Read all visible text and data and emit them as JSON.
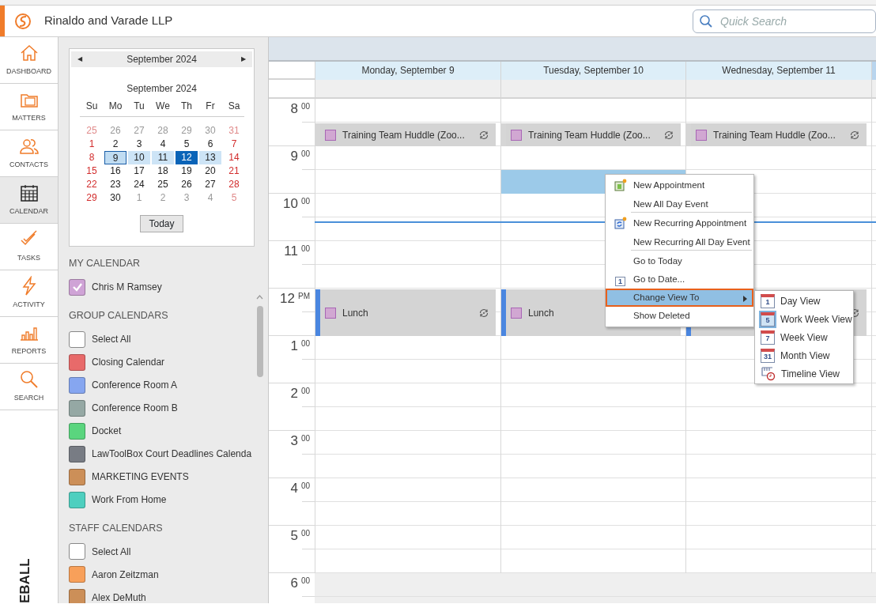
{
  "app": {
    "title": "Rinaldo and Varade LLP",
    "search_placeholder": "Quick Search"
  },
  "nav": [
    {
      "label": "DASHBOARD",
      "selected": false
    },
    {
      "label": "MATTERS",
      "selected": false
    },
    {
      "label": "CONTACTS",
      "selected": false
    },
    {
      "label": "CALENDAR",
      "selected": true
    },
    {
      "label": "TASKS",
      "selected": false
    },
    {
      "label": "ACTIVITY",
      "selected": false
    },
    {
      "label": "REPORTS",
      "selected": false
    },
    {
      "label": "SEARCH",
      "selected": false
    }
  ],
  "brand_vertical": "EBALL",
  "mini_calendar": {
    "header_title": "September 2024",
    "prev": "◀",
    "next": "▶",
    "title": "September 2024",
    "weekdays": [
      "Su",
      "Mo",
      "Tu",
      "We",
      "Th",
      "Fr",
      "Sa"
    ],
    "weeks": [
      [
        {
          "day": "25",
          "in_month": false,
          "selected": false,
          "today": false,
          "focused": false
        },
        {
          "day": "26",
          "in_month": false,
          "selected": false,
          "today": false,
          "focused": false
        },
        {
          "day": "27",
          "in_month": false,
          "selected": false,
          "today": false,
          "focused": false
        },
        {
          "day": "28",
          "in_month": false,
          "selected": false,
          "today": false,
          "focused": false
        },
        {
          "day": "29",
          "in_month": false,
          "selected": false,
          "today": false,
          "focused": false
        },
        {
          "day": "30",
          "in_month": false,
          "selected": false,
          "today": false,
          "focused": false
        },
        {
          "day": "31",
          "in_month": false,
          "selected": false,
          "today": false,
          "focused": false
        }
      ],
      [
        {
          "day": "1",
          "in_month": true,
          "selected": false,
          "today": false,
          "focused": false
        },
        {
          "day": "2",
          "in_month": true,
          "selected": false,
          "today": false,
          "focused": false
        },
        {
          "day": "3",
          "in_month": true,
          "selected": false,
          "today": false,
          "focused": false
        },
        {
          "day": "4",
          "in_month": true,
          "selected": false,
          "today": false,
          "focused": false
        },
        {
          "day": "5",
          "in_month": true,
          "selected": false,
          "today": false,
          "focused": false
        },
        {
          "day": "6",
          "in_month": true,
          "selected": false,
          "today": false,
          "focused": false
        },
        {
          "day": "7",
          "in_month": true,
          "selected": false,
          "today": false,
          "focused": false
        }
      ],
      [
        {
          "day": "8",
          "in_month": true,
          "selected": false,
          "today": false,
          "focused": false
        },
        {
          "day": "9",
          "in_month": true,
          "selected": true,
          "today": true,
          "focused": false
        },
        {
          "day": "10",
          "in_month": true,
          "selected": true,
          "today": false,
          "focused": false
        },
        {
          "day": "11",
          "in_month": true,
          "selected": true,
          "today": false,
          "focused": false
        },
        {
          "day": "12",
          "in_month": true,
          "selected": true,
          "today": false,
          "focused": true
        },
        {
          "day": "13",
          "in_month": true,
          "selected": true,
          "today": false,
          "focused": false
        },
        {
          "day": "14",
          "in_month": true,
          "selected": false,
          "today": false,
          "focused": false
        }
      ],
      [
        {
          "day": "15",
          "in_month": true,
          "selected": false,
          "today": false,
          "focused": false
        },
        {
          "day": "16",
          "in_month": true,
          "selected": false,
          "today": false,
          "focused": false
        },
        {
          "day": "17",
          "in_month": true,
          "selected": false,
          "today": false,
          "focused": false
        },
        {
          "day": "18",
          "in_month": true,
          "selected": false,
          "today": false,
          "focused": false
        },
        {
          "day": "19",
          "in_month": true,
          "selected": false,
          "today": false,
          "focused": false
        },
        {
          "day": "20",
          "in_month": true,
          "selected": false,
          "today": false,
          "focused": false
        },
        {
          "day": "21",
          "in_month": true,
          "selected": false,
          "today": false,
          "focused": false
        }
      ],
      [
        {
          "day": "22",
          "in_month": true,
          "selected": false,
          "today": false,
          "focused": false
        },
        {
          "day": "23",
          "in_month": true,
          "selected": false,
          "today": false,
          "focused": false
        },
        {
          "day": "24",
          "in_month": true,
          "selected": false,
          "today": false,
          "focused": false
        },
        {
          "day": "25",
          "in_month": true,
          "selected": false,
          "today": false,
          "focused": false
        },
        {
          "day": "26",
          "in_month": true,
          "selected": false,
          "today": false,
          "focused": false
        },
        {
          "day": "27",
          "in_month": true,
          "selected": false,
          "today": false,
          "focused": false
        },
        {
          "day": "28",
          "in_month": true,
          "selected": false,
          "today": false,
          "focused": false
        }
      ],
      [
        {
          "day": "29",
          "in_month": true,
          "selected": false,
          "today": false,
          "focused": false
        },
        {
          "day": "30",
          "in_month": true,
          "selected": false,
          "today": false,
          "focused": false
        },
        {
          "day": "1",
          "in_month": false,
          "selected": false,
          "today": false,
          "focused": false
        },
        {
          "day": "2",
          "in_month": false,
          "selected": false,
          "today": false,
          "focused": false
        },
        {
          "day": "3",
          "in_month": false,
          "selected": false,
          "today": false,
          "focused": false
        },
        {
          "day": "4",
          "in_month": false,
          "selected": false,
          "today": false,
          "focused": false
        },
        {
          "day": "5",
          "in_month": false,
          "selected": false,
          "today": false,
          "focused": false
        }
      ]
    ],
    "today_button": "Today"
  },
  "calendar_sections": [
    {
      "title": "MY CALENDAR",
      "items": [
        {
          "label": "Chris M Ramsey",
          "color": "#cfa3d6",
          "checked": true
        }
      ]
    },
    {
      "title": "GROUP CALENDARS",
      "items": [
        {
          "label": "Select All",
          "checked": false
        },
        {
          "label": "Closing Calendar",
          "color": "#e86a6a",
          "checked": false
        },
        {
          "label": "Conference Room A",
          "color": "#86a6f0",
          "checked": false
        },
        {
          "label": "Conference Room B",
          "color": "#95a8a4",
          "checked": false
        },
        {
          "label": "Docket",
          "color": "#5ad57e",
          "checked": false
        },
        {
          "label": "LawToolBox Court Deadlines Calenda",
          "color": "#787c84",
          "checked": false
        },
        {
          "label": "MARKETING EVENTS",
          "color": "#cc8f58",
          "checked": false
        },
        {
          "label": "Work From Home",
          "color": "#4ecfbf",
          "checked": false
        }
      ]
    },
    {
      "title": "STAFF CALENDARS",
      "items": [
        {
          "label": "Select All",
          "checked": false
        },
        {
          "label": "Aaron Zeitzman",
          "color": "#f8a05a",
          "checked": false
        },
        {
          "label": "Alex DeMuth",
          "color": "#cc8f58",
          "checked": false
        }
      ]
    }
  ],
  "day_columns": [
    {
      "label": "Monday, September 9",
      "has_selection": false,
      "events": [
        {
          "title": "Training Team Huddle (Zoo...",
          "color": "#d6d6d6",
          "recurring": true
        },
        {
          "title": "Lunch",
          "color": "#4a86e0",
          "recurring": true
        }
      ]
    },
    {
      "label": "Tuesday, September 10",
      "has_selection": true,
      "events": [
        {
          "title": "Training Team Huddle (Zoo...",
          "color": "#d6d6d6",
          "recurring": true
        },
        {
          "title": "Lunch",
          "color": "#4a86e0",
          "recurring": false
        }
      ]
    },
    {
      "label": "Wednesday, September 11",
      "has_selection": false,
      "events": [
        {
          "title": "Training Team Huddle (Zoo...",
          "color": "#d6d6d6",
          "recurring": true
        },
        {
          "color": "#4a86e0",
          "recurring": true
        }
      ]
    }
  ],
  "hours": [
    {
      "hour": "8",
      "suffix": "00"
    },
    {
      "hour": "9",
      "suffix": "00"
    },
    {
      "hour": "10",
      "suffix": "00"
    },
    {
      "hour": "11",
      "suffix": "00"
    },
    {
      "hour": "12",
      "suffix": "PM"
    },
    {
      "hour": "1",
      "suffix": "00"
    },
    {
      "hour": "2",
      "suffix": "00"
    },
    {
      "hour": "3",
      "suffix": "00"
    },
    {
      "hour": "4",
      "suffix": "00"
    },
    {
      "hour": "5",
      "suffix": "00"
    },
    {
      "hour": "6",
      "suffix": "00"
    }
  ],
  "context_menu": {
    "items": [
      {
        "label": "New Appointment",
        "divider_below": false,
        "selected": false,
        "has_submenu": false
      },
      {
        "label": "New All Day Event",
        "divider_below": true,
        "selected": false,
        "has_submenu": false
      },
      {
        "label": "New Recurring Appointment",
        "divider_below": false,
        "selected": false,
        "has_submenu": false
      },
      {
        "label": "New Recurring All Day Event",
        "divider_below": true,
        "selected": false,
        "has_submenu": false
      },
      {
        "label": "Go to Today",
        "divider_below": false,
        "selected": false,
        "has_submenu": false
      },
      {
        "label": "Go to Date...",
        "icon_text": "1",
        "divider_below": false,
        "selected": false,
        "has_submenu": false
      },
      {
        "label": "Change View To",
        "divider_below": false,
        "selected": true,
        "has_submenu": true
      },
      {
        "label": "Show Deleted",
        "divider_below": false,
        "selected": false,
        "has_submenu": false
      }
    ],
    "submenu": [
      {
        "label": "Day View",
        "icon_text": "1",
        "selected": false
      },
      {
        "label": "Work Week View",
        "icon_text": "5",
        "selected": true
      },
      {
        "label": "Week View",
        "icon_text": "7",
        "selected": false
      },
      {
        "label": "Month View",
        "icon_text": "31",
        "selected": false
      },
      {
        "label": "Timeline View",
        "selected": false
      }
    ]
  }
}
